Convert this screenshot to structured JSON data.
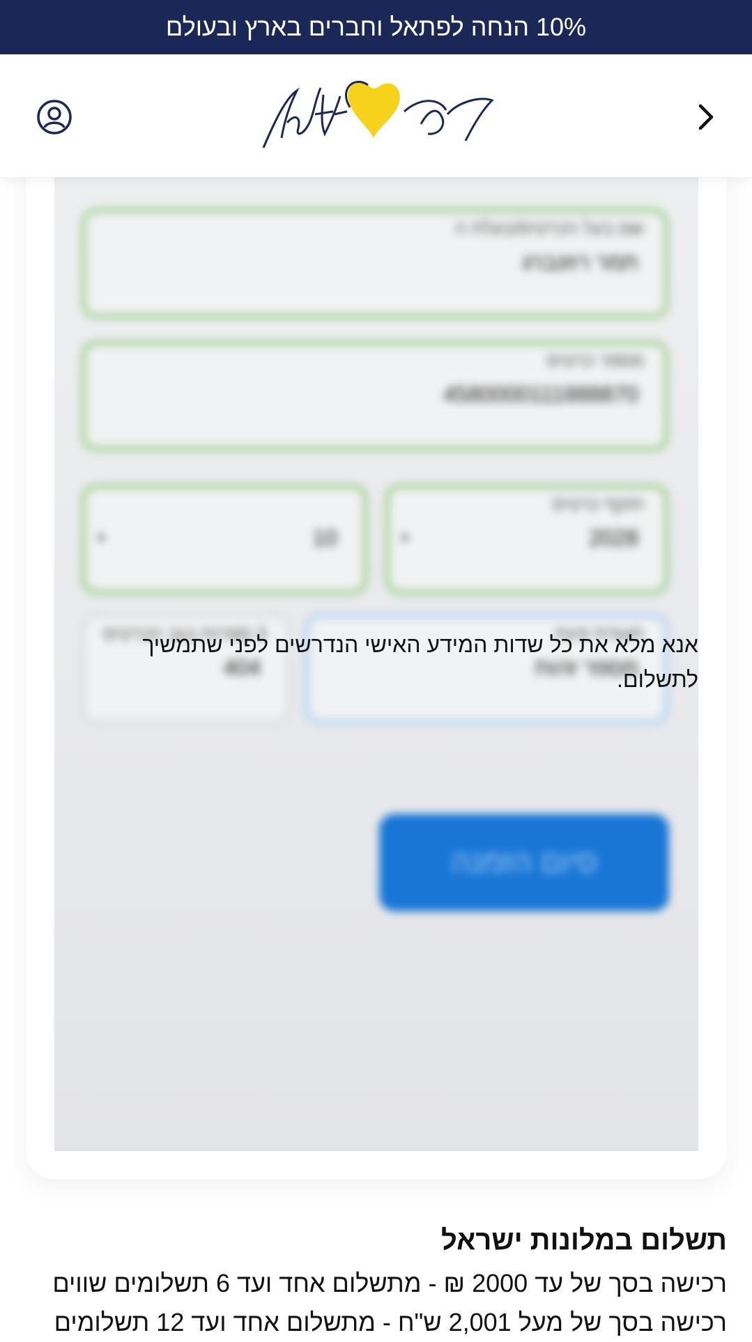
{
  "promo_banner": {
    "text": "10% הנחה לפתאל וחברים בארץ ובעולם"
  },
  "header": {
    "logo_text_hebrew": "פתאל",
    "logo_text_latin": "fattal",
    "user_icon": "user-circle-icon",
    "back_icon": "chevron-icon"
  },
  "payment_form": {
    "card_holder": {
      "label": "שם בעל הכרטיס/בעלת ה",
      "value": "תמר רוזנברג"
    },
    "card_number": {
      "label": "מספר כרטיס",
      "value": "4580000111888870"
    },
    "expiry_year": {
      "label": "תוקף כרטיס",
      "value": "2028"
    },
    "expiry_month": {
      "value": "10"
    },
    "id_number": {
      "label": "תעודת זהות",
      "value": "מספר זהות"
    },
    "cvv": {
      "label": "3 ספרות בגב הכרטיס",
      "value": "404"
    },
    "submit_label": "סיום הזמנה",
    "message": "אנא מלא את כל שדות המידע האישי הנדרשים לפני שתמשיך לתשלום."
  },
  "payment_info": {
    "title": "תשלום במלונות ישראל",
    "lines": [
      "רכישה בסך של עד 2000 ₪ - מתשלום אחד ועד 6 תשלומים שווים",
      "רכישה בסך של מעל 2,001 ש\"ח  - מתשלום אחד ועד 12 תשלומים"
    ]
  },
  "colors": {
    "promo_bg": "#1b2756",
    "brand_navy": "#1b2756",
    "brand_yellow": "#f7d21c",
    "button_blue": "#1976d6",
    "field_border_valid": "#a9d39b"
  }
}
